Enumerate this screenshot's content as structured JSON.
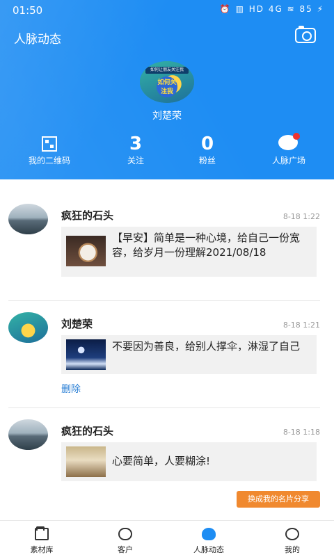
{
  "status_bar": {
    "time": "01:50",
    "icons": "⏰ ▥ HD 4G ≋ 85 ⚡"
  },
  "header": {
    "title": "人脉动态",
    "avatar_banner": "如何让朋友关注我",
    "avatar_center": "如何关注我",
    "username": "刘楚荣",
    "qr_label": "我的二维码",
    "follow_count": "3",
    "follow_label": "关注",
    "fans_count": "0",
    "fans_label": "粉丝",
    "square_label": "人脉广场"
  },
  "posts": [
    {
      "author": "疯狂的石头",
      "time": "8-18 1:22",
      "text": "【早安】简单是一种心境，给自己一份宽容，给岁月一份理解2021/08/18"
    },
    {
      "author": "刘楚荣",
      "time": "8-18 1:21",
      "text": "不要因为善良，给别人撑伞，淋湿了自己",
      "delete_label": "删除"
    },
    {
      "author": "疯狂的石头",
      "time": "8-18 1:18",
      "text": "心要简单，人要糊涂!"
    }
  ],
  "share_button": "换成我的名片分享",
  "tabbar": [
    {
      "label": "素材库",
      "icon": "folder-icon"
    },
    {
      "label": "客户",
      "icon": "users-icon"
    },
    {
      "label": "人脉动态",
      "icon": "network-icon"
    },
    {
      "label": "我的",
      "icon": "user-icon"
    }
  ]
}
